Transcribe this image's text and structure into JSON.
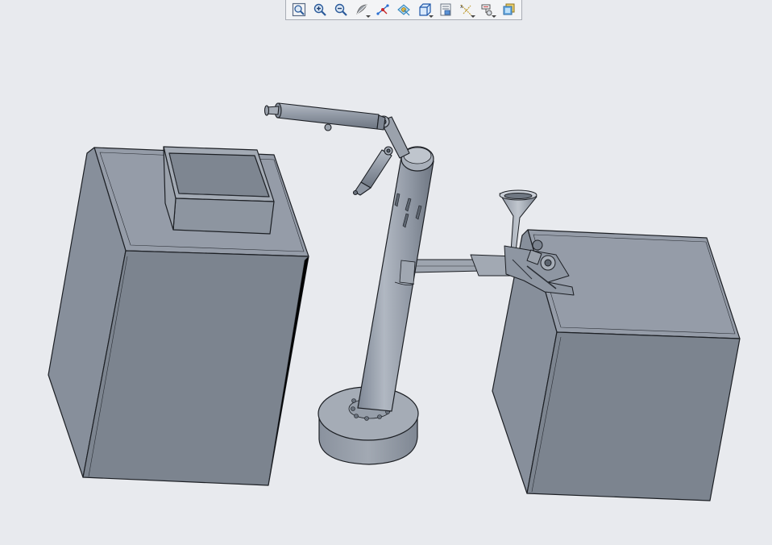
{
  "app": {
    "title": ""
  },
  "toolbar": {
    "buttons": [
      {
        "name": "zoom-refit",
        "icon": "refit-icon"
      },
      {
        "name": "zoom-in",
        "icon": "zoom-in-icon"
      },
      {
        "name": "zoom-out",
        "icon": "zoom-out-icon"
      },
      {
        "name": "shading-style",
        "icon": "shading-icon",
        "dropdown": true
      },
      {
        "name": "datum-axis",
        "icon": "axis-display-icon"
      },
      {
        "name": "datum-points",
        "icon": "point-display-icon"
      },
      {
        "name": "saved-views",
        "icon": "saved-view-icon",
        "dropdown": true
      },
      {
        "name": "view-manager",
        "icon": "view-manager-icon"
      },
      {
        "name": "datum-display",
        "icon": "datum-display-icon",
        "dropdown": true
      },
      {
        "name": "annotation-display",
        "icon": "annotation-display-icon",
        "dropdown": true
      },
      {
        "name": "appearance",
        "icon": "appearance-icon"
      }
    ]
  },
  "viewport": {
    "background": "#e8eaee",
    "model_color": "#8e96a3",
    "model_shade_dark": "#7b838f",
    "model_shade_light": "#9aa2ad",
    "edge_color": "#1c1f24"
  }
}
